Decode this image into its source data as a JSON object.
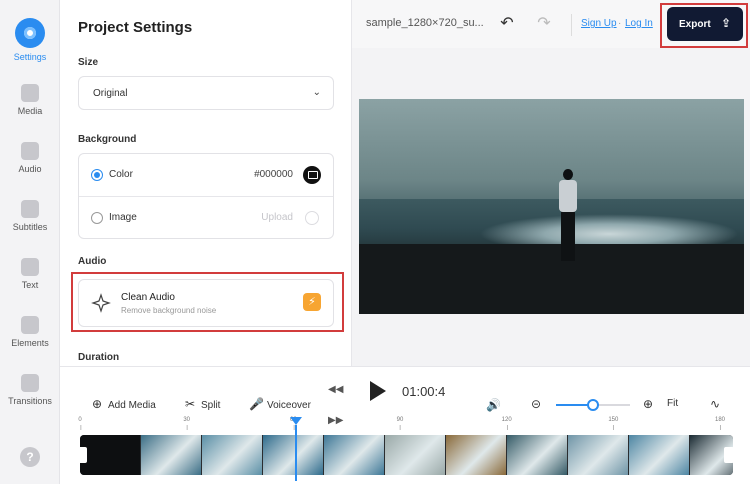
{
  "sidebar": {
    "items": [
      {
        "label": "Settings",
        "icon": "settings-icon",
        "active": true
      },
      {
        "label": "Media",
        "icon": "media-icon"
      },
      {
        "label": "Audio",
        "icon": "audio-icon"
      },
      {
        "label": "Subtitles",
        "icon": "subtitles-icon"
      },
      {
        "label": "Text",
        "icon": "text-icon"
      },
      {
        "label": "Elements",
        "icon": "elements-icon"
      },
      {
        "label": "Transitions",
        "icon": "transitions-icon"
      }
    ],
    "help": "?"
  },
  "panel": {
    "title": "Project Settings",
    "size_label": "Size",
    "size_value": "Original",
    "background_label": "Background",
    "color_label": "Color",
    "color_value": "#000000",
    "image_label": "Image",
    "upload_label": "Upload",
    "audio_label": "Audio",
    "clean_audio_title": "Clean Audio",
    "clean_audio_subtitle": "Remove background noise",
    "duration_label": "Duration"
  },
  "topbar": {
    "filename": "sample_1280×720_su...",
    "signup": "Sign Up",
    "separator": "·",
    "login": "Log In",
    "export": "Export"
  },
  "controls": {
    "add_media": "Add Media",
    "split": "Split",
    "voiceover": "Voiceover",
    "time": "01:00:4",
    "fit": "Fit",
    "zoom_level": 0.5
  },
  "ruler": {
    "ticks": [
      "0",
      "30",
      "60",
      "90",
      "120",
      "150",
      "180"
    ]
  },
  "colors": {
    "accent": "#2a8cf0",
    "export_bg": "#111a33",
    "highlight": "#d23c3c",
    "bolt": "#f7a532"
  }
}
